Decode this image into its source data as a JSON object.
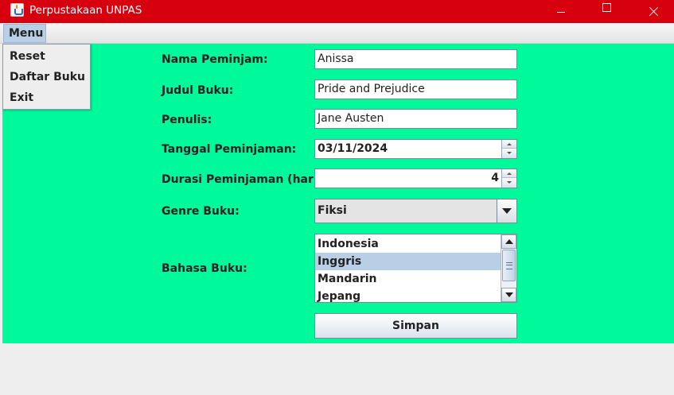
{
  "window": {
    "title": "Perpustakaan UNPAS"
  },
  "menubar": {
    "menu_label": "Menu"
  },
  "popup_menu": {
    "items": [
      "Reset",
      "Daftar Buku",
      "Exit"
    ]
  },
  "form": {
    "nama_label": "Nama Peminjam:",
    "nama_value": "Anissa",
    "judul_label": "Judul Buku:",
    "judul_value": "Pride and Prejudice",
    "penulis_label": "Penulis:",
    "penulis_value": "Jane Austen",
    "tanggal_label": "Tanggal Peminjaman:",
    "tanggal_value": "03/11/2024",
    "durasi_label": "Durasi Peminjaman (hari):",
    "durasi_value": "4",
    "genre_label": "Genre Buku:",
    "genre_value": "Fiksi",
    "bahasa_label": "Bahasa Buku:",
    "bahasa_options": [
      "Indonesia",
      "Inggris",
      "Mandarin",
      "Jepang"
    ],
    "bahasa_selected": "Inggris",
    "submit_label": "Simpan"
  },
  "colors": {
    "titlebar": "#d7000f",
    "content_background": "#00f99a",
    "selection": "#b8cfe5"
  },
  "icons": {
    "app": "java-cup-icon",
    "minimize": "minimize-icon",
    "maximize": "maximize-icon",
    "close": "close-icon"
  }
}
